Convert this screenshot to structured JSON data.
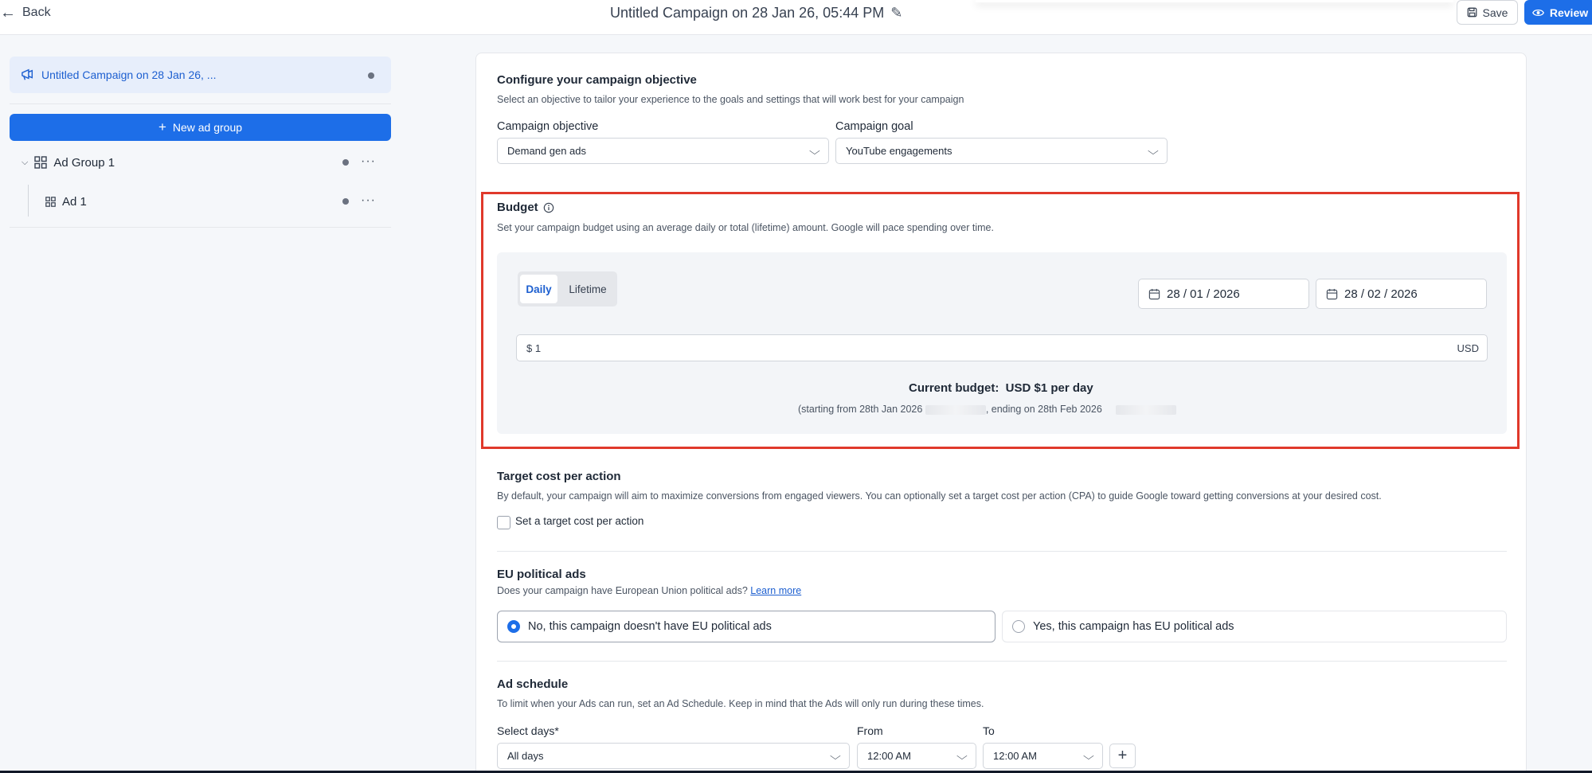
{
  "header": {
    "back_label": "Back",
    "title": "Untitled Campaign on 28 Jan 26, 05:44 PM",
    "save_label": "Save",
    "review_label": "Review"
  },
  "sidebar": {
    "campaign_label": "Untitled Campaign on 28 Jan 26, ...",
    "new_ad_group_label": "New ad group",
    "ad_group_label": "Ad Group 1",
    "ad_label": "Ad 1",
    "more_glyph": "···"
  },
  "objective": {
    "heading": "Configure your campaign objective",
    "description": "Select an objective to tailor your experience to the goals and settings that will work best for your campaign",
    "objective_label": "Campaign objective",
    "objective_value": "Demand gen ads",
    "goal_label": "Campaign goal",
    "goal_value": "YouTube engagements"
  },
  "budget": {
    "heading": "Budget",
    "description": "Set your campaign budget using an average daily or total (lifetime) amount. Google will pace spending over time.",
    "tab_daily": "Daily",
    "tab_lifetime": "Lifetime",
    "start_date": "28 / 01 / 2026",
    "end_date": "28 / 02 / 2026",
    "amount": "$ 1",
    "currency": "USD",
    "current_label": "Current budget:",
    "current_value": "USD $1 per day",
    "period_start": "(starting from 28th Jan 2026",
    "period_end": ", ending on 28th Feb 2026"
  },
  "cpa": {
    "heading": "Target cost per action",
    "description": "By default, your campaign will aim to maximize conversions from engaged viewers. You can optionally set a target cost per action (CPA) to guide Google toward getting conversions at your desired cost.",
    "checkbox_label": "Set a target cost per action"
  },
  "eu": {
    "heading": "EU political ads",
    "description": "Does your campaign have European Union political ads?",
    "learn_more": "Learn more",
    "option_no": "No, this campaign doesn't have EU political ads",
    "option_yes": "Yes, this campaign has EU political ads",
    "selected": "no"
  },
  "schedule": {
    "heading": "Ad schedule",
    "description": "To limit when your Ads can run, set an Ad Schedule. Keep in mind that the Ads will only run during these times.",
    "days_label": "Select days*",
    "days_value": "All days",
    "from_label": "From",
    "from_value": "12:00 AM",
    "to_label": "To",
    "to_value": "12:00 AM",
    "add_glyph": "+"
  },
  "colors": {
    "accent": "#1d6ee8",
    "highlight": "#e0392b"
  }
}
